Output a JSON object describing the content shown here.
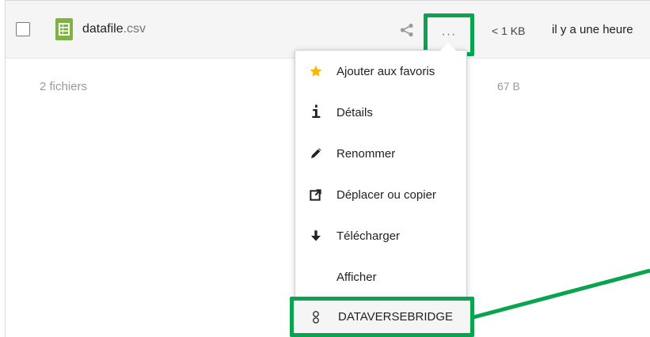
{
  "file": {
    "name_base": "datafile",
    "name_ext": ".csv",
    "size": "< 1 KB",
    "modified": "il y a une heure",
    "more_label": "···"
  },
  "summary": {
    "count": "2 fichiers",
    "size": "67 B"
  },
  "menu": {
    "items": [
      {
        "label": "Ajouter aux favoris",
        "icon": "star-icon"
      },
      {
        "label": "Détails",
        "icon": "info-icon"
      },
      {
        "label": "Renommer",
        "icon": "pencil-icon"
      },
      {
        "label": "Déplacer ou copier",
        "icon": "external-link-icon"
      },
      {
        "label": "Télécharger",
        "icon": "download-icon"
      },
      {
        "label": "Afficher",
        "icon": ""
      },
      {
        "label": "DATAVERSEBRIDGE",
        "icon": "dataverse-icon"
      }
    ]
  },
  "colors": {
    "highlight": "#0aa34f",
    "file_icon": "#7cb342",
    "star": "#f9b800"
  }
}
